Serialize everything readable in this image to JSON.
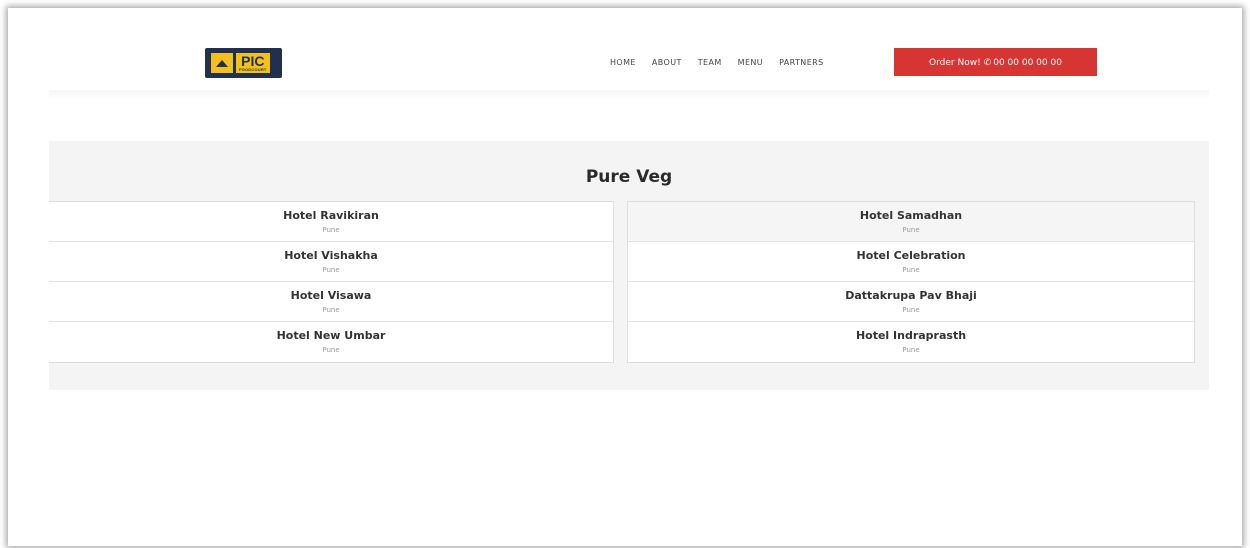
{
  "header": {
    "logo_text": "PIC",
    "logo_subtext": "FOODCOURT",
    "nav": [
      "HOME",
      "ABOUT",
      "TEAM",
      "MENU",
      "PARTNERS"
    ],
    "order_label": "Order Now!",
    "order_phone": "00 00 00 00 00",
    "order_color": "#d73434"
  },
  "section": {
    "title": "Pure Veg",
    "left": [
      {
        "name": "Hotel Ravikiran",
        "city": "Pune"
      },
      {
        "name": "Hotel Vishakha",
        "city": "Pune"
      },
      {
        "name": "Hotel Visawa",
        "city": "Pune"
      },
      {
        "name": "Hotel New Umbar",
        "city": "Pune"
      }
    ],
    "right": [
      {
        "name": "Hotel Samadhan",
        "city": "Pune"
      },
      {
        "name": "Hotel Celebration",
        "city": "Pune"
      },
      {
        "name": "Dattakrupa Pav Bhaji",
        "city": "Pune"
      },
      {
        "name": "Hotel Indraprasth",
        "city": "Pune"
      }
    ]
  }
}
